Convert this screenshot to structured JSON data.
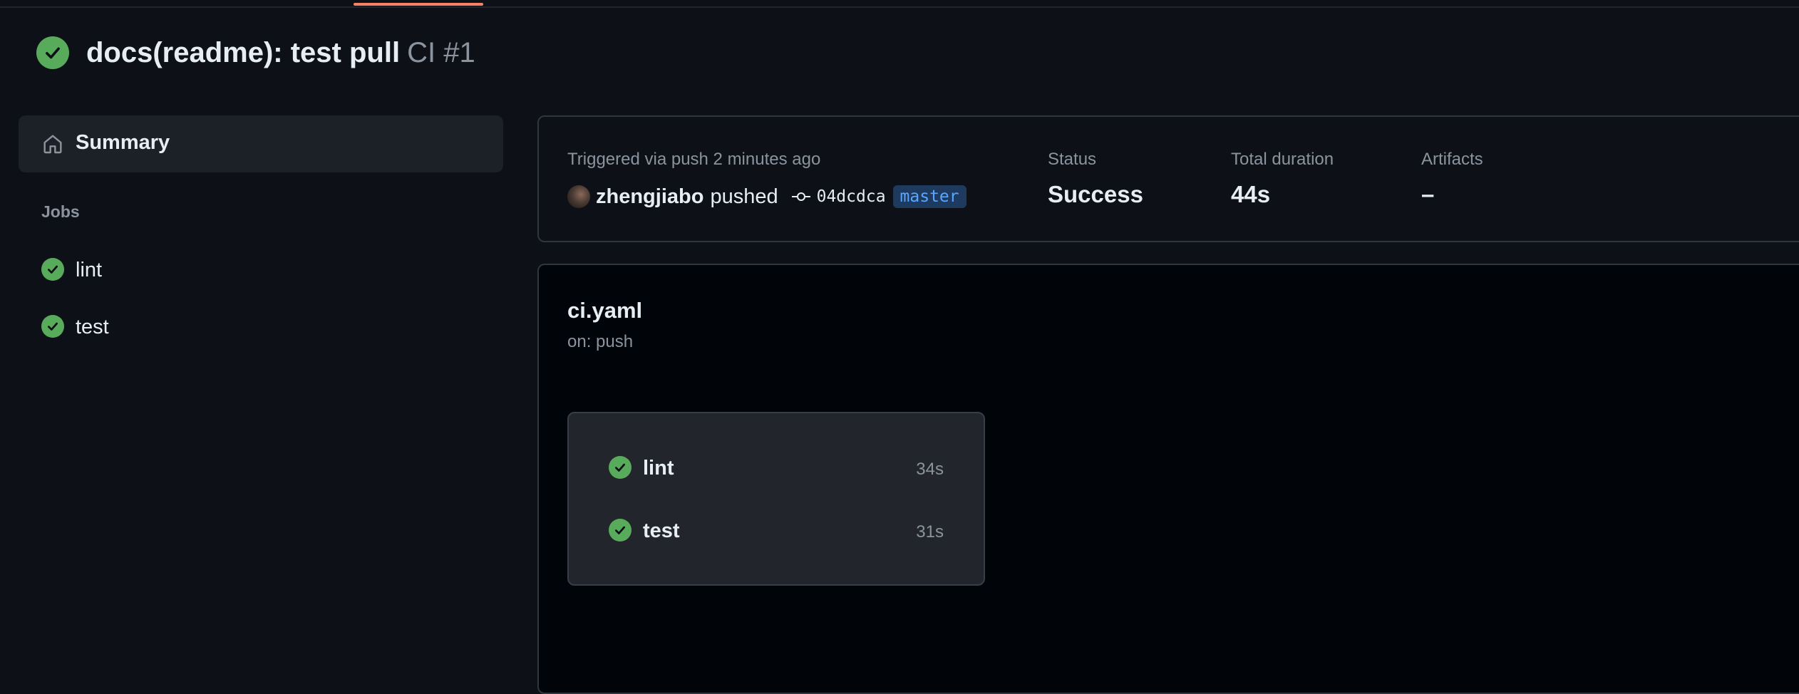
{
  "run": {
    "title": "docs(readme): test pull",
    "run_label": "CI #1",
    "status_icon": "check-circle-icon",
    "status_color": "#57ab5a"
  },
  "sidebar": {
    "summary_label": "Summary",
    "summary_icon": "home-icon",
    "jobs_heading": "Jobs",
    "jobs": [
      {
        "label": "lint"
      },
      {
        "label": "test"
      }
    ]
  },
  "info": {
    "trigger_text": "Triggered via push 2 minutes ago",
    "actor": "zhengjiabo",
    "action": "pushed",
    "commit_sha": "04dcdca",
    "branch": "master",
    "status_label": "Status",
    "status_value": "Success",
    "duration_label": "Total duration",
    "duration_value": "44s",
    "artifacts_label": "Artifacts",
    "artifacts_value": "–"
  },
  "workflow": {
    "name": "ci.yaml",
    "trigger": "on: push",
    "jobs": [
      {
        "name": "lint",
        "duration": "34s"
      },
      {
        "name": "test",
        "duration": "31s"
      }
    ]
  },
  "colors": {
    "accent_tab": "#f78166",
    "success": "#57ab5a",
    "branch_text": "#58a6ff"
  }
}
